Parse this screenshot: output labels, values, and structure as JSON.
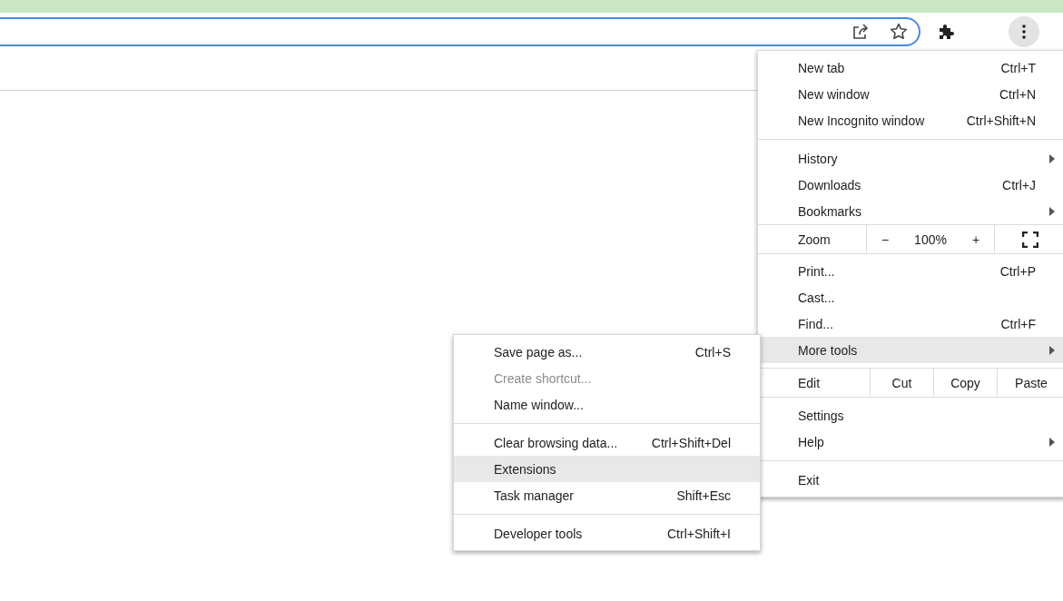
{
  "menu": {
    "items": [
      {
        "kind": "item",
        "label": "New tab",
        "shortcut": "Ctrl+T",
        "has_submenu": false,
        "selected": false
      },
      {
        "kind": "item",
        "label": "New window",
        "shortcut": "Ctrl+N",
        "has_submenu": false,
        "selected": false
      },
      {
        "kind": "item",
        "label": "New Incognito window",
        "shortcut": "Ctrl+Shift+N",
        "has_submenu": false,
        "selected": false
      },
      {
        "kind": "separator"
      },
      {
        "kind": "item",
        "label": "History",
        "has_submenu": true,
        "selected": false
      },
      {
        "kind": "item",
        "label": "Downloads",
        "shortcut": "Ctrl+J",
        "has_submenu": false,
        "selected": false
      },
      {
        "kind": "item",
        "label": "Bookmarks",
        "has_submenu": true,
        "selected": false
      },
      {
        "kind": "zoom",
        "label": "Zoom",
        "minus": "−",
        "value": "100%",
        "plus": "+"
      },
      {
        "kind": "item",
        "label": "Print...",
        "shortcut": "Ctrl+P",
        "has_submenu": false,
        "selected": false
      },
      {
        "kind": "item",
        "label": "Cast...",
        "has_submenu": false,
        "selected": false
      },
      {
        "kind": "item",
        "label": "Find...",
        "shortcut": "Ctrl+F",
        "has_submenu": false,
        "selected": false
      },
      {
        "kind": "item",
        "label": "More tools",
        "has_submenu": true,
        "selected": true
      },
      {
        "kind": "edit",
        "label": "Edit",
        "actions": [
          "Cut",
          "Copy",
          "Paste"
        ]
      },
      {
        "kind": "item",
        "label": "Settings",
        "has_submenu": false,
        "selected": false
      },
      {
        "kind": "item",
        "label": "Help",
        "has_submenu": true,
        "selected": false
      },
      {
        "kind": "separator"
      },
      {
        "kind": "item",
        "label": "Exit",
        "has_submenu": false,
        "selected": false
      }
    ]
  },
  "submenu": {
    "items": [
      {
        "kind": "item",
        "label": "Save page as...",
        "shortcut": "Ctrl+S",
        "disabled": false,
        "selected": false
      },
      {
        "kind": "item",
        "label": "Create shortcut...",
        "disabled": true,
        "selected": false
      },
      {
        "kind": "item",
        "label": "Name window...",
        "disabled": false,
        "selected": false
      },
      {
        "kind": "separator"
      },
      {
        "kind": "item",
        "label": "Clear browsing data...",
        "shortcut": "Ctrl+Shift+Del",
        "disabled": false,
        "selected": false
      },
      {
        "kind": "item",
        "label": "Extensions",
        "disabled": false,
        "selected": true
      },
      {
        "kind": "item",
        "label": "Task manager",
        "shortcut": "Shift+Esc",
        "disabled": false,
        "selected": false
      },
      {
        "kind": "separator"
      },
      {
        "kind": "item",
        "label": "Developer tools",
        "shortcut": "Ctrl+Shift+I",
        "disabled": false,
        "selected": false
      }
    ]
  }
}
